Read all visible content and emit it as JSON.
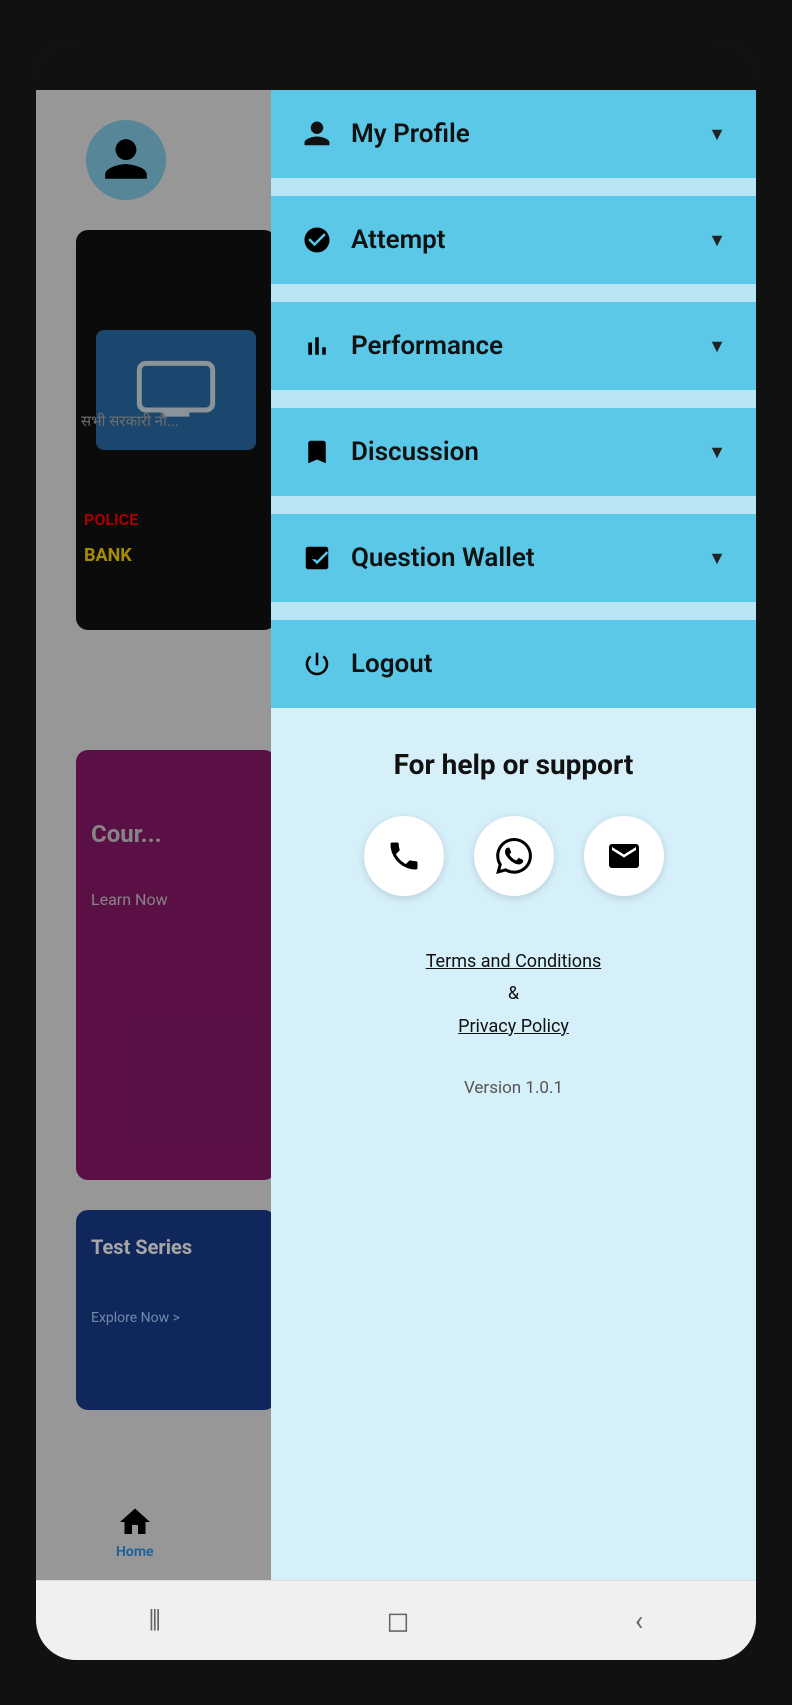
{
  "drawer": {
    "menu_items": [
      {
        "id": "my-profile",
        "label": "My Profile",
        "icon": "person-icon",
        "has_chevron": true
      },
      {
        "id": "attempt",
        "label": "Attempt",
        "icon": "checkmark-circle-icon",
        "has_chevron": true
      },
      {
        "id": "performance",
        "label": "Performance",
        "icon": "bar-chart-icon",
        "has_chevron": true
      },
      {
        "id": "discussion",
        "label": "Discussion",
        "icon": "bookmark-icon",
        "has_chevron": true
      },
      {
        "id": "question-wallet",
        "label": "Question Wallet",
        "icon": "receipt-icon",
        "has_chevron": true
      }
    ],
    "logout_label": "Logout",
    "logout_icon": "power-icon"
  },
  "support": {
    "title": "For help or support",
    "phone_icon": "phone-icon",
    "whatsapp_icon": "whatsapp-icon",
    "email_icon": "email-icon"
  },
  "links": {
    "terms_label": "Terms and Conditions",
    "and_label": "&",
    "privacy_label": "Privacy Policy"
  },
  "version": {
    "label": "Version 1.0.1"
  },
  "background": {
    "card1_text": "सभी सरकारी नौ...",
    "police_text": "POLICE",
    "bank_text": "BANK",
    "course_text": "Cour...",
    "learn_text": "Learn Now",
    "test_series_text": "Test Series",
    "explore_text": "Explore Now >"
  },
  "bottom_nav": {
    "menu_icon": "menu-icon",
    "home_icon": "home-icon",
    "back_icon": "back-icon",
    "home_label": "Home"
  }
}
